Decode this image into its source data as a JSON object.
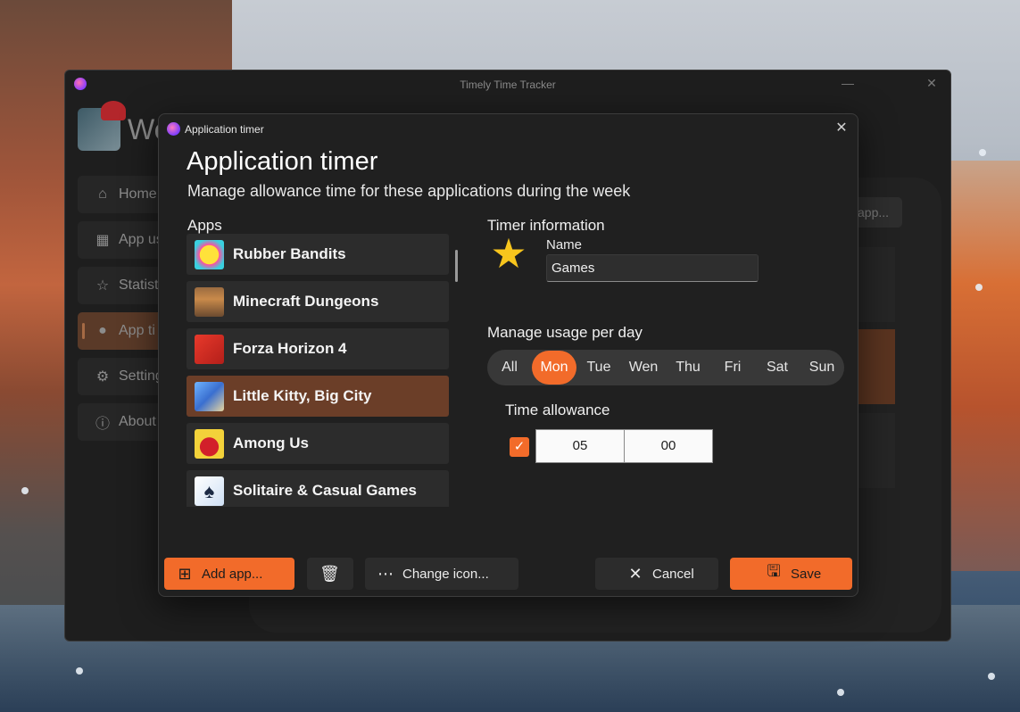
{
  "main_window": {
    "title": "Timely Time Tracker",
    "minimize_glyph": "—",
    "close_glyph": "✕",
    "welcome_text": "We",
    "nav": [
      {
        "label": "Home",
        "icon": "home-icon"
      },
      {
        "label": "App us",
        "icon": "calendar-icon"
      },
      {
        "label": "Statist",
        "icon": "star-outline-icon"
      },
      {
        "label": "App ti",
        "icon": "lightbulb-icon"
      },
      {
        "label": "Setting",
        "icon": "gear-icon"
      },
      {
        "label": "About",
        "icon": "info-icon"
      }
    ],
    "bg_button": "app..."
  },
  "dialog": {
    "caption": "Application timer",
    "close_glyph": "✕",
    "heading": "Application timer",
    "subheading": "Manage allowance time for these applications during the week",
    "apps_label": "Apps",
    "apps": [
      {
        "name": "Rubber Bandits",
        "icon": "rubber-bandits-icon"
      },
      {
        "name": "Minecraft Dungeons",
        "icon": "minecraft-dungeons-icon"
      },
      {
        "name": "Forza Horizon 4",
        "icon": "forza-horizon-icon"
      },
      {
        "name": "Little Kitty, Big City",
        "icon": "little-kitty-icon",
        "selected": true
      },
      {
        "name": "Among Us",
        "icon": "among-us-icon"
      },
      {
        "name": "Solitaire & Casual Games",
        "icon": "solitaire-icon"
      }
    ],
    "timer_info_label": "Timer information",
    "timer_icon": "star-icon",
    "name_label": "Name",
    "name_value": "Games",
    "manage_label": "Manage usage per day",
    "days": [
      "All",
      "Mon",
      "Tue",
      "Wen",
      "Thu",
      "Fri",
      "Sat",
      "Sun"
    ],
    "active_day": "Mon",
    "allowance_label": "Time allowance",
    "allowance_enabled": true,
    "hours": "05",
    "minutes": "00",
    "buttons": {
      "add": "Add app...",
      "change_icon": "Change icon...",
      "cancel": "Cancel",
      "save": "Save"
    },
    "accent_color": "#f26b2a",
    "selected_color": "#6b3e28"
  }
}
